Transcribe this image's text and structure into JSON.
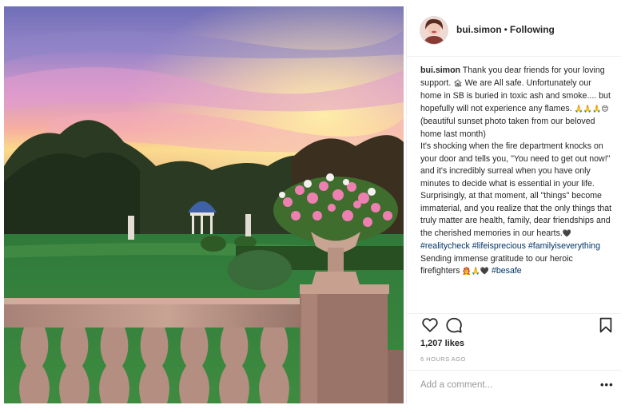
{
  "post": {
    "username": "bui.simon",
    "separator": "•",
    "follow_state": "Following",
    "caption": {
      "username": "bui.simon",
      "seg1": "Thank you dear friends for your loving support.",
      "emoji1": "🏚",
      "seg2": "We are All safe. Unfortunately our home in SB is buried in toxic ash and smoke.... but hopefully will not experience any flames.",
      "emoji2": "🙏🙏🙏😊",
      "seg3": "(beautiful sunset photo taken from our beloved home last month)",
      "seg4": "It's shocking when the fire department knocks on your door and tells you, \"You need to get out now!\" and it's incredibly surreal when you have only minutes to decide what is essential in your life. Surprisingly, at that moment, all \"things\" become immaterial, and you realize that the only things that truly matter are health, family, dear friendships and the cherished memories in our hearts.",
      "emoji3": "🖤",
      "tag1": "#realitycheck",
      "tag2": "#lifeisprecious",
      "tag3": "#familyiseverything",
      "seg5": "Sending immense gratitude to our heroic firefighters",
      "emoji4": "👨‍🚒🙏🖤",
      "tag4": "#besafe"
    },
    "likes": "1,207 likes",
    "time": "6 HOURS AGO",
    "comment_placeholder": "Add a comment...",
    "more_label": "•••",
    "icons": [
      "heart-icon",
      "comment-icon",
      "bookmark-icon"
    ]
  }
}
